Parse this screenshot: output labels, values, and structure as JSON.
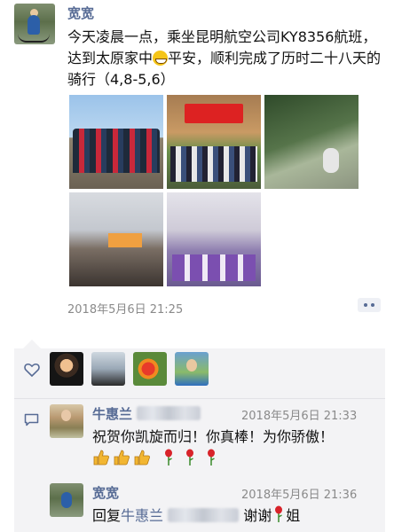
{
  "post": {
    "author": "宽宽",
    "text_before_emoji": "今天凌晨一点，乘坐昆明航空公司KY8356航班，达到太原家中",
    "text_after_emoji": "平安，顺利完成了历时二十八天的骑行（4,8-5,6）",
    "emoji": "grinning-face",
    "photo_count": 5,
    "timestamp": "2018年5月6日 21:25"
  },
  "likes": {
    "icon": "heart-icon",
    "count": 4
  },
  "comments": [
    {
      "name": "牛惠兰",
      "time": "2018年5月6日 21:33",
      "text": "祝贺你凯旋而归！你真棒！为你骄傲！",
      "emoji": [
        "thumbs-up",
        "thumbs-up",
        "thumbs-up",
        "rose",
        "rose",
        "rose"
      ]
    },
    {
      "name": "宽宽",
      "time": "2018年5月6日 21:36",
      "reply_prefix": "回复",
      "reply_to": "牛惠兰",
      "text_mid": "谢谢",
      "text_end": "姐",
      "emoji": [
        "rose"
      ]
    }
  ],
  "colors": {
    "link_blue": "#576b95",
    "time_gray": "#8a8a8a",
    "panel_bg": "#f3f3f5"
  }
}
